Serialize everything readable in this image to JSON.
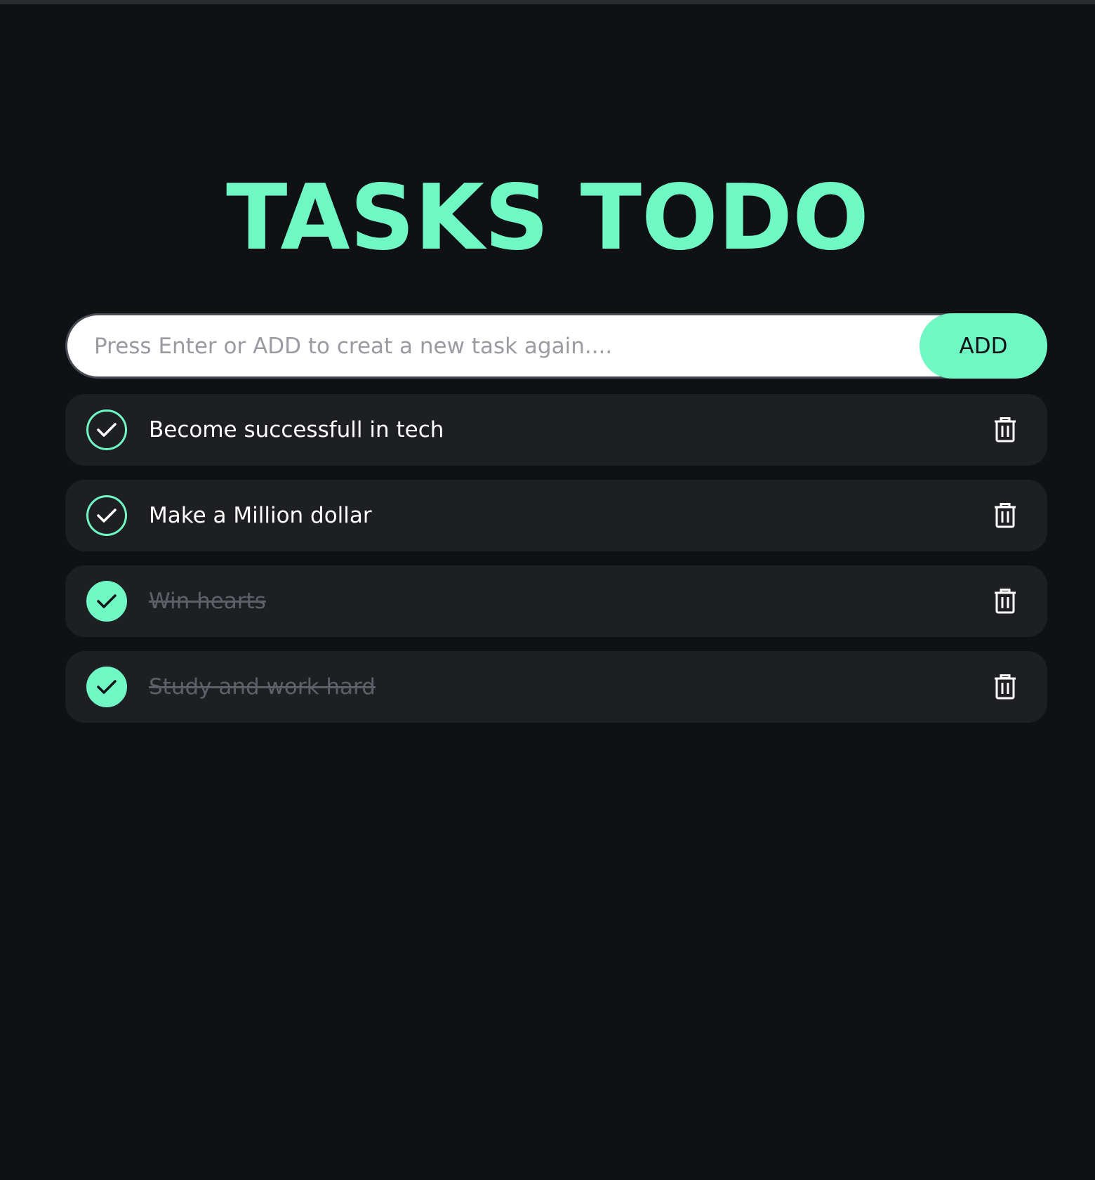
{
  "app": {
    "title": "TASKS TODO",
    "accent_color": "#6ff7c4",
    "background_color": "#0f1115"
  },
  "input": {
    "placeholder": "Press Enter or ADD to creat a new task again....",
    "value": "",
    "add_label": "ADD"
  },
  "tasks": [
    {
      "text": "Become successfull in tech",
      "completed": false
    },
    {
      "text": "Make a Million dollar",
      "completed": false
    },
    {
      "text": "Win hearts",
      "completed": true
    },
    {
      "text": "Study and work hard",
      "completed": true
    }
  ],
  "icons": {
    "check": "check-icon",
    "delete": "trash-icon"
  }
}
